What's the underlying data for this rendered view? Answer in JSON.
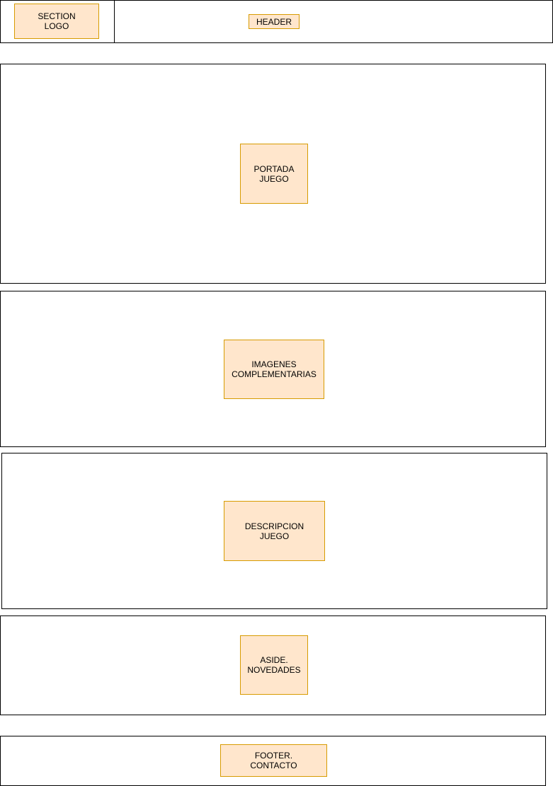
{
  "header_row": {
    "logo_label": "SECTION\nLOGO",
    "header_label": "HEADER"
  },
  "sections": {
    "portada_label": "PORTADA\nJUEGO",
    "imagenes_label": "IMAGENES\nCOMPLEMENTARIAS",
    "descripcion_label": "DESCRIPCION\nJUEGO",
    "aside_label": "ASIDE.\nNOVEDADES",
    "footer_label": "FOOTER.\nCONTACTO"
  },
  "colors": {
    "frame_border": "#000000",
    "box_fill": "#ffe6cc",
    "box_border": "#d79b00"
  }
}
